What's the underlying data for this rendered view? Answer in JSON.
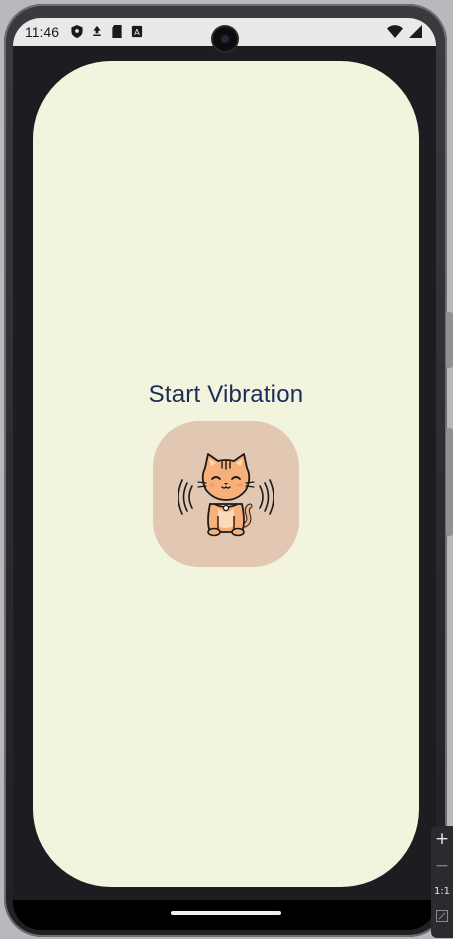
{
  "status_bar": {
    "time": "11:46",
    "left_icons": [
      "shield-icon",
      "data-saver-icon",
      "sd-card-icon",
      "keyboard-a-icon"
    ],
    "right_icons": [
      "wifi-icon",
      "signal-icon"
    ]
  },
  "main": {
    "title": "Start Vibration",
    "button_icon": "vibrating-cat-icon"
  },
  "zoom_controls": {
    "zoom_in": "+",
    "zoom_out": "−",
    "actual_size": "1:1"
  },
  "colors": {
    "surface": "#f3f4de",
    "title": "#1c2b57",
    "button": "#e2c7b3",
    "cat_fill": "#f7b07a"
  }
}
